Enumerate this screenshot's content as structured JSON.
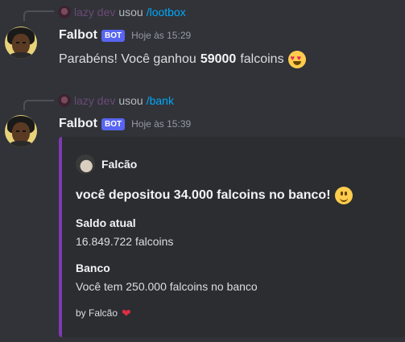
{
  "messages": [
    {
      "reply": {
        "username": "lazy dev",
        "used": "usou",
        "command": "/lootbox"
      },
      "author": "Falbot",
      "tag": "BOT",
      "timestamp": "Hoje às 15:29",
      "content_prefix": "Parabéns! Você ganhou",
      "content_amount": "59000",
      "content_suffix": "falcoins",
      "emoji": "heart-eyes-emoji"
    },
    {
      "reply": {
        "username": "lazy dev",
        "used": "usou",
        "command": "/bank"
      },
      "author": "Falbot",
      "tag": "BOT",
      "timestamp": "Hoje às 15:39",
      "embed": {
        "color": "#7d3ab5",
        "author_name": "Falcão",
        "title": "você depositou 34.000 falcoins no banco!",
        "title_emoji": "slightly-smiling-emoji",
        "fields": [
          {
            "name": "Saldo atual",
            "value": "16.849.722 falcoins"
          },
          {
            "name": "Banco",
            "value": "Você tem 250.000 falcoins no banco"
          }
        ],
        "footer_text": "by Falcão",
        "footer_emoji": "red-heart-emoji"
      }
    }
  ],
  "colors": {
    "background": "#313338",
    "embed_bg": "#2b2d31",
    "command": "#00a8fc",
    "bot_tag": "#5865f2"
  }
}
